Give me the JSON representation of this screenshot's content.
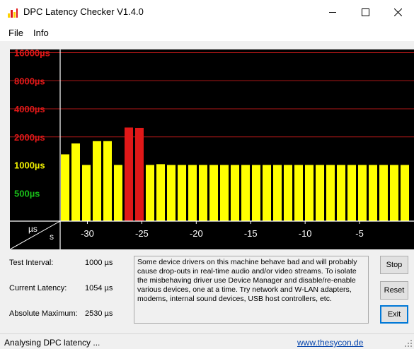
{
  "window": {
    "title": "DPC Latency Checker V1.4.0",
    "controls": {
      "minimize": "minimize-icon",
      "maximize": "maximize-icon",
      "close": "close-icon"
    }
  },
  "menu": {
    "items": [
      "File",
      "Info"
    ]
  },
  "chart_data": {
    "type": "bar",
    "ylabel": "µs",
    "xlabel": "s",
    "y_scale": "log",
    "y_ticks": [
      {
        "label": "16000µs",
        "value": 16000,
        "color": "#e01818",
        "gridline": true
      },
      {
        "label": "8000µs",
        "value": 8000,
        "color": "#e01818",
        "gridline": true
      },
      {
        "label": "4000µs",
        "value": 4000,
        "color": "#e01818",
        "gridline": true
      },
      {
        "label": "2000µs",
        "value": 2000,
        "color": "#e01818",
        "gridline": true
      },
      {
        "label": "1000µs",
        "value": 1000,
        "color": "#f0f000",
        "gridline": false
      },
      {
        "label": "500µs",
        "value": 500,
        "color": "#19c219",
        "gridline": false
      }
    ],
    "x_ticks": [
      "-30",
      "-25",
      "-20",
      "-15",
      "-10",
      "-5"
    ],
    "x_tick_values": [
      -30,
      -25,
      -20,
      -15,
      -10,
      -5
    ],
    "x_range": [
      -32.5,
      0
    ],
    "bar_colors": {
      "normal": "#ffff00",
      "high": "#e01818"
    },
    "threshold": 2000,
    "values": [
      1300,
      1700,
      1000,
      1800,
      1800,
      1000,
      2520,
      2500,
      1000,
      1020,
      1000,
      1000,
      1000,
      1000,
      1000,
      1000,
      1000,
      1000,
      1000,
      1000,
      1000,
      1000,
      1000,
      1000,
      1000,
      1000,
      1000,
      1000,
      1000,
      1000,
      1000,
      1000,
      1000,
      1020,
      1000,
      1000,
      1000,
      1000,
      1000,
      1000,
      1000,
      1000,
      1000
    ]
  },
  "info": {
    "test_interval_label": "Test Interval:",
    "test_interval_value": "1000 µs",
    "current_latency_label": "Current Latency:",
    "current_latency_value": "1054 µs",
    "absolute_max_label": "Absolute Maximum:",
    "absolute_max_value": "2530 µs"
  },
  "message": "Some device drivers on this machine behave bad and will probably cause drop-outs in real-time audio and/or video streams. To isolate the misbehaving driver use Device Manager and disable/re-enable various devices, one at a time. Try network and W-LAN adapters, modems, internal sound devices, USB host controllers, etc.",
  "buttons": {
    "stop": "Stop",
    "reset": "Reset",
    "exit": "Exit"
  },
  "status": {
    "text": "Analysing DPC latency ...",
    "link": "www.thesycon.de"
  }
}
